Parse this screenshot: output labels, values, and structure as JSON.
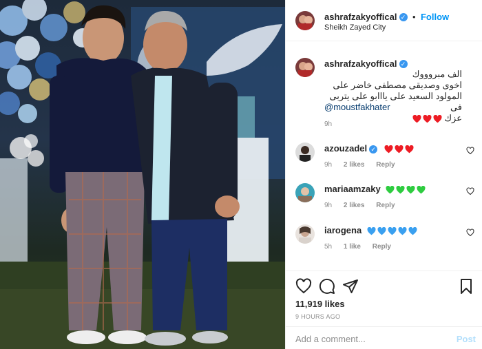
{
  "post": {
    "author": "ashrafzakyoffical",
    "follow_label": "Follow",
    "follow_separator": "•",
    "location": "Sheikh Zayed City",
    "caption_lines": [
      "الف مبروووك",
      "اخوى وصديقى مصطفى خاضر على",
      "المولود السعيد على يااابو على يتربى فى",
      "عزك"
    ],
    "caption_mention": "@moustfakhater",
    "caption_time": "9h",
    "colors": {
      "accent": "#0095f6",
      "verified": "#3897f0",
      "heart": "#ed1c24",
      "green_heart": "#2ecc40",
      "blue_heart": "#3aa0f0"
    }
  },
  "comments": [
    {
      "user": "azouzadel",
      "verified": true,
      "hearts": 3,
      "heart_color": "red",
      "time": "9h",
      "likes": "2 likes",
      "reply": "Reply"
    },
    {
      "user": "mariaamzaky",
      "verified": false,
      "hearts": 4,
      "heart_color": "green",
      "time": "9h",
      "likes": "2 likes",
      "reply": "Reply"
    },
    {
      "user": "iarogena",
      "verified": false,
      "hearts": 5,
      "heart_color": "blue",
      "time": "5h",
      "likes": "1 like",
      "reply": "Reply"
    }
  ],
  "actions": {
    "likes_count": "11,919 likes",
    "time_ago": "9 HOURS AGO",
    "icons": [
      "heart-icon",
      "comment-icon",
      "share-icon",
      "bookmark-icon"
    ]
  },
  "composer": {
    "placeholder": "Add a comment...",
    "post_label": "Post"
  }
}
